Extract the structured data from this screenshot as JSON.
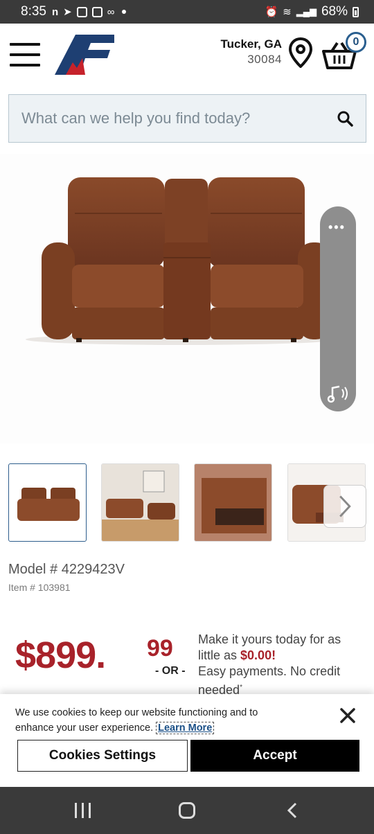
{
  "status_bar": {
    "time": "8:35",
    "battery": "68%"
  },
  "header": {
    "location": {
      "city": "Tucker, GA",
      "zip": "30084"
    },
    "cart_count": "0",
    "search": {
      "placeholder": "What can we help you find today?"
    }
  },
  "product": {
    "model_label": "Model # 4229423V",
    "item_label": "Item # 103981",
    "price": {
      "dollars": "$899.",
      "cents": "99"
    },
    "or_label": "- OR -",
    "financing": {
      "line1": "Make it yours today for as",
      "line2_prefix": "little as ",
      "amount": "$0.00!",
      "line3": "Easy payments. No credit",
      "line4": "needed",
      "footnote_mark": "*"
    }
  },
  "cookie_banner": {
    "text": "We use cookies to keep our website functioning and to enhance your user experience.",
    "learn_more": "Learn More",
    "settings_button": "Cookies Settings",
    "accept_button": "Accept"
  },
  "overlay": {
    "menu_dots": "•••"
  },
  "colors": {
    "brand_blue": "#1e3f72",
    "brand_red": "#c6222b",
    "price_red": "#a8222a",
    "leather": "#7a3f22"
  }
}
